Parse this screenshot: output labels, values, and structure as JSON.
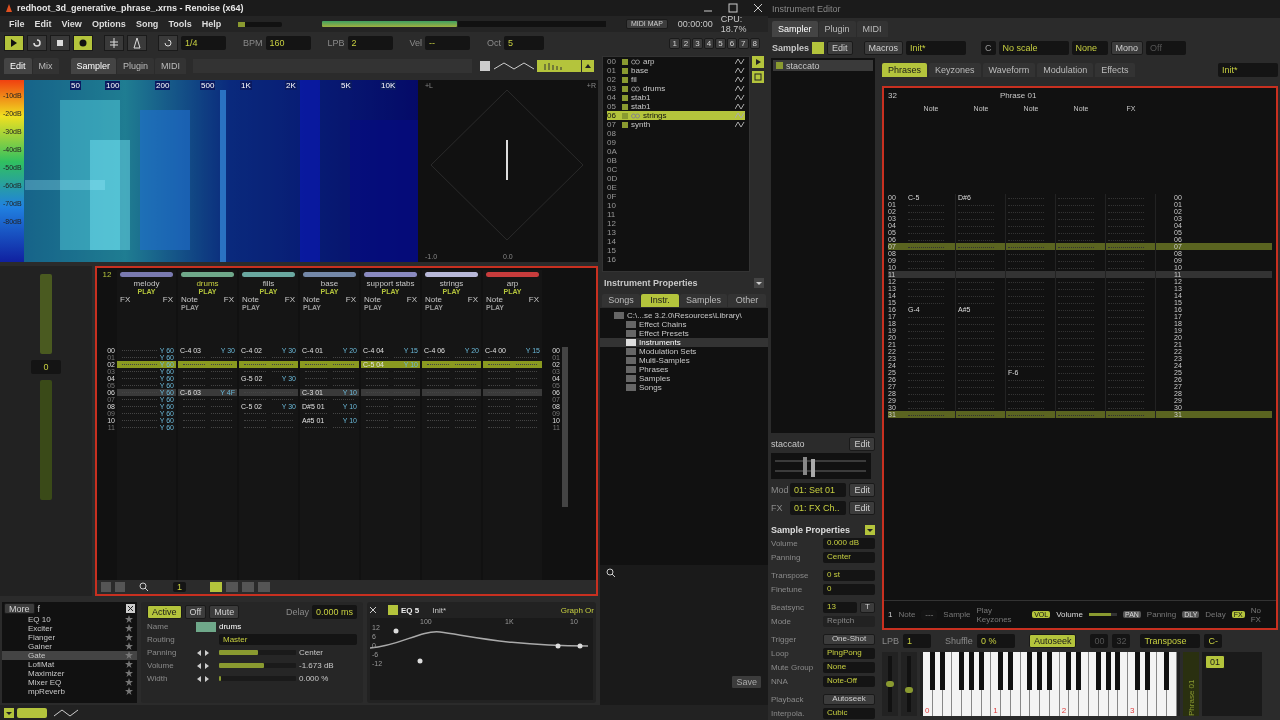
{
  "window": {
    "title": "redhoot_3d_generative_phrase_.xrns - Renoise (x64)"
  },
  "menu": [
    "File",
    "Edit",
    "View",
    "Options",
    "Song",
    "Tools",
    "Help"
  ],
  "transport": {
    "buttons": [
      {
        "kind": "play",
        "on": true
      },
      {
        "kind": "loop",
        "on": false
      },
      {
        "kind": "stop",
        "on": false
      },
      {
        "kind": "record",
        "on": true
      }
    ],
    "quantize": "1/4",
    "bpm_label": "BPM",
    "bpm": "160",
    "lpb_label": "LPB",
    "lpb": "2",
    "vel_label": "Vel",
    "vel": "--",
    "oct_label": "Oct",
    "oct": "5"
  },
  "status": {
    "master_volume": {
      "level": 0.15
    },
    "midi_map": "MIDI MAP",
    "time": "00:00:00",
    "cpu": "CPU: 18.7%",
    "track_buttons": [
      "1",
      "2",
      "3",
      "4",
      "5",
      "6",
      "7",
      "8"
    ]
  },
  "view_tabs": [
    {
      "label": "Edit",
      "selected": true
    },
    {
      "label": "Mix",
      "selected": false
    }
  ],
  "lower_tabs": [
    {
      "label": "Sampler",
      "selected": true
    },
    {
      "label": "Plugin",
      "selected": false
    },
    {
      "label": "MIDI",
      "selected": false
    }
  ],
  "spectrum": {
    "db_labels": [
      "-10dB",
      "-20dB",
      "-30dB",
      "-40dB",
      "-50dB",
      "-60dB",
      "-70dB",
      "-80dB"
    ],
    "freq_labels": [
      "50",
      "100",
      "200",
      "500",
      "1K",
      "2K",
      "5K",
      "10K"
    ],
    "scope_labels": [
      "+L",
      "+R",
      "-1.0",
      "0.0"
    ]
  },
  "mixer_strip": {
    "value": "0"
  },
  "pattern": {
    "lines_label": "12",
    "right_line_numbers": [
      "00",
      "01",
      "02",
      "03",
      "04",
      "05",
      "06",
      "07",
      "08",
      "09",
      "10",
      "11"
    ],
    "line_numbers": [
      {
        "label": "00",
        "kind": "even"
      },
      {
        "label": "01",
        "kind": "odd"
      },
      {
        "label": "02",
        "kind": "play"
      },
      {
        "label": "03",
        "kind": "odd"
      },
      {
        "label": "04",
        "kind": "even"
      },
      {
        "label": "05",
        "kind": "odd"
      },
      {
        "label": "06",
        "kind": "cursor"
      },
      {
        "label": "07",
        "kind": "odd"
      },
      {
        "label": "08",
        "kind": "even"
      },
      {
        "label": "09",
        "kind": "odd"
      },
      {
        "label": "10",
        "kind": "even"
      },
      {
        "label": "11",
        "kind": "odd"
      }
    ],
    "tracks": [
      {
        "name": "melody",
        "color": "#7a7ab0",
        "button_label": "PLAY",
        "columns": [
          "FX",
          "FX"
        ],
        "cells": [
          {
            "fx": "Y 60"
          },
          {
            "fx": "Y 60"
          },
          {
            "fx": "Y 60"
          },
          {
            "fx": "Y 60"
          },
          {
            "fx": "Y 60"
          },
          {
            "fx": "Y 60"
          },
          {
            "fx": "Y 60"
          },
          {
            "fx": "Y 60"
          },
          {
            "fx": "Y 60"
          },
          {
            "fx": "Y 60"
          },
          {
            "fx": "Y 60"
          },
          {
            "fx": "Y 60"
          }
        ]
      },
      {
        "name": "drums",
        "color": "#6fa88a",
        "button_label": "PLAY",
        "columns": [
          "Note",
          "FX"
        ],
        "sub_label": "PLAY",
        "cells": [
          {
            "note": "C-4 03",
            "fx": "Y 30"
          },
          {},
          {},
          {},
          {},
          {},
          {
            "note": "C-6 03",
            "fx": "Y 4F"
          },
          {},
          {},
          {},
          {},
          {}
        ]
      },
      {
        "name": "fills",
        "color": "#6aa8a0",
        "button_label": "PLAY",
        "columns": [
          "Note",
          "FX"
        ],
        "sub_label": "PLAY",
        "cells": [
          {
            "note": "C-4 02",
            "fx": "Y 30"
          },
          {},
          {},
          {},
          {
            "note": "G-5 02",
            "fx": "Y 30"
          },
          {},
          {},
          {},
          {
            "note": "C-5 02",
            "fx": "Y 30"
          },
          {},
          {},
          {}
        ]
      },
      {
        "name": "base",
        "color": "#7488a8",
        "button_label": "PLAY",
        "columns": [
          "Note",
          "FX"
        ],
        "sub_label": "PLAY",
        "cells": [
          {
            "note": "C-4 01",
            "fx": "Y 20"
          },
          {},
          {},
          {},
          {},
          {},
          {
            "note": "C-3 01",
            "fx": "Y 10"
          },
          {},
          {
            "note": "D#5 01",
            "fx": "Y 10"
          },
          {},
          {
            "note": "A#5 01",
            "fx": "Y 10"
          },
          {}
        ]
      },
      {
        "name": "support stabs",
        "color": "#8a8ac0",
        "button_label": "PLAY",
        "columns": [
          "Note",
          "FX"
        ],
        "sub_label": "PLAY",
        "cells": [
          {
            "note": "C-4 04",
            "fx": "Y 15"
          },
          {},
          {
            "note": "C-5 04",
            "fx": "Y 10"
          },
          {},
          {},
          {},
          {},
          {},
          {},
          {},
          {},
          {}
        ]
      },
      {
        "name": "strings",
        "color": "#b8b8d8",
        "button_label": "PLAY",
        "columns": [
          "Note",
          "FX"
        ],
        "sub_label": "PLAY",
        "cells": [
          {
            "note": "C-4 06",
            "fx": "Y 20"
          },
          {},
          {},
          {},
          {},
          {},
          {},
          {},
          {},
          {},
          {},
          {}
        ]
      },
      {
        "name": "arp",
        "color": "#c83c3c",
        "button_label": "PLAY",
        "columns": [
          "Note",
          "FX"
        ],
        "sub_label": "PLAY",
        "cells": [
          {
            "note": "C-4 00",
            "fx": "Y 15"
          },
          {},
          {},
          {},
          {},
          {},
          {},
          {},
          {},
          {},
          {},
          {}
        ]
      }
    ]
  },
  "pattern_toolbar": {
    "value": "1"
  },
  "dsp_list": {
    "more": "More",
    "filter": "f",
    "items": [
      {
        "label": "EQ 10",
        "selected": false
      },
      {
        "label": "Exciter",
        "selected": false
      },
      {
        "label": "Flanger",
        "selected": false
      },
      {
        "label": "Gainer",
        "selected": false
      },
      {
        "label": "Gate",
        "selected": true
      },
      {
        "label": "LofiMat",
        "selected": false
      },
      {
        "label": "Maximizer",
        "selected": false
      },
      {
        "label": "Mixer EQ",
        "selected": false
      },
      {
        "label": "mpReverb",
        "selected": false
      }
    ]
  },
  "track_props": {
    "buttons": [
      {
        "label": "Active",
        "selected": true
      },
      {
        "label": "Off",
        "selected": false
      },
      {
        "label": "Mute",
        "selected": false
      }
    ],
    "delay_label": "Delay",
    "delay": "0.000 ms",
    "name_label": "Name",
    "name": "drums",
    "routing_label": "Routing",
    "routing": "Master",
    "sliders": [
      {
        "label": "Panning",
        "level": 0.5,
        "reading": "Center"
      },
      {
        "label": "Volume",
        "level": 0.58,
        "reading": "-1.673 dB"
      },
      {
        "label": "Width",
        "level": 0.02,
        "reading": "0.000 %"
      }
    ]
  },
  "eq_device": {
    "title": "EQ 5",
    "enabled": true,
    "preset": "Init*",
    "graph_button": "Graph Or",
    "freq_labels": [
      "100",
      "1K",
      "10"
    ],
    "gain_labels": [
      "12",
      "6",
      "0",
      "-6",
      "-12"
    ]
  },
  "instruments": {
    "items": [
      {
        "number": "00",
        "name": "arp",
        "linked": true,
        "selected": false
      },
      {
        "number": "01",
        "name": "base",
        "linked": false,
        "selected": false
      },
      {
        "number": "02",
        "name": "fil",
        "linked": false,
        "selected": false
      },
      {
        "number": "03",
        "name": "drums",
        "linked": true,
        "selected": false
      },
      {
        "number": "04",
        "name": "stab1",
        "linked": false,
        "selected": false
      },
      {
        "number": "05",
        "name": "stab1",
        "linked": false,
        "selected": false
      },
      {
        "number": "06",
        "name": "strings",
        "linked": true,
        "selected": true
      },
      {
        "number": "07",
        "name": "synth",
        "linked": false,
        "selected": false
      },
      {
        "number": "08"
      },
      {
        "number": "09"
      },
      {
        "number": "0A"
      },
      {
        "number": "0B"
      },
      {
        "number": "0C"
      },
      {
        "number": "0D"
      },
      {
        "number": "0E"
      },
      {
        "number": "0F"
      },
      {
        "number": "10"
      },
      {
        "number": "11"
      },
      {
        "number": "12"
      },
      {
        "number": "13"
      },
      {
        "number": "14"
      },
      {
        "number": "15"
      },
      {
        "number": "16"
      }
    ],
    "properties_label": "Instrument Properties"
  },
  "browser": {
    "tabs": [
      {
        "label": "Songs",
        "selected": false
      },
      {
        "label": "Instr.",
        "selected": true
      },
      {
        "label": "Samples",
        "selected": false
      },
      {
        "label": "Other",
        "selected": false
      }
    ],
    "path": "C:\\...se 3.2.0\\Resources\\Library\\",
    "folders": [
      {
        "label": "Effect Chains",
        "selected": false
      },
      {
        "label": "Effect Presets",
        "selected": false
      },
      {
        "label": "Instruments",
        "selected": true
      },
      {
        "label": "Modulation Sets",
        "selected": false
      },
      {
        "label": "Multi-Samples",
        "selected": false
      },
      {
        "label": "Phrases",
        "selected": false
      },
      {
        "label": "Samples",
        "selected": false
      },
      {
        "label": "Songs",
        "selected": false
      }
    ],
    "save": "Save"
  },
  "instrument_editor": {
    "title": "Instrument Editor",
    "tabs": [
      {
        "label": "Sampler",
        "selected": true
      },
      {
        "label": "Plugin",
        "selected": false
      },
      {
        "label": "MIDI",
        "selected": false
      }
    ],
    "samples_label": "Samples",
    "samples_edit": "Edit",
    "macros": "Macros",
    "preset": "Init*",
    "key": "C",
    "scale": "No scale",
    "chord": "None",
    "mono": "Mono",
    "glide": "Off",
    "samples": [
      {
        "name": "staccato",
        "selected": true
      }
    ],
    "sample_header": {
      "name": "staccato",
      "edit": "Edit"
    },
    "mod_label": "Mod",
    "mod": "01: Set 01",
    "mod_edit": "Edit",
    "fx_label": "FX",
    "fx": "01: FX Ch..",
    "fx_edit": "Edit",
    "sample_props_title": "Sample Properties",
    "props": [
      {
        "label": "Volume",
        "value": "0.000 dB",
        "kind": "stepper"
      },
      {
        "label": "Panning",
        "value": "Center",
        "kind": "stepper"
      },
      {
        "label": "Transpose",
        "value": "0 st",
        "kind": "stepper"
      },
      {
        "label": "Finetune",
        "value": "0",
        "kind": "stepper"
      },
      {
        "label": "Beatsync",
        "value": "13",
        "kind": "beatsync",
        "extra": "T"
      },
      {
        "label": "Mode",
        "value": "Repitch",
        "kind": "disabled"
      },
      {
        "label": "Trigger",
        "value": "One-Shot",
        "kind": "button"
      },
      {
        "label": "Loop",
        "value": "PingPong",
        "kind": "dropdown"
      },
      {
        "label": "Mute Group",
        "value": "None",
        "kind": "dropdown"
      },
      {
        "label": "NNA",
        "value": "Note-Off",
        "kind": "dropdown"
      },
      {
        "label": "Playback",
        "value": "Autoseek",
        "kind": "button"
      },
      {
        "label": "Interpola.",
        "value": "Cubic",
        "kind": "dropdown"
      }
    ],
    "phrase_tabs": [
      {
        "label": "Phrases",
        "selected": true
      },
      {
        "label": "Keyzones",
        "selected": false
      },
      {
        "label": "Waveform",
        "selected": false
      },
      {
        "label": "Modulation",
        "selected": false
      },
      {
        "label": "Effects",
        "selected": false
      }
    ],
    "phrase_preset": "Init*",
    "phrase": {
      "lines_label": "32",
      "right_labels": [
        "00",
        "01",
        "02",
        "03",
        "04",
        "05",
        "06",
        "07",
        "08",
        "09",
        "10",
        "11",
        "12",
        "13",
        "14",
        "15",
        "16",
        "17",
        "18",
        "19",
        "20",
        "21",
        "22",
        "23",
        "24",
        "25",
        "26",
        "27",
        "28",
        "29",
        "30",
        "31"
      ],
      "title": "Phrase 01",
      "columns": [
        "Note",
        "Note",
        "Note",
        "Note",
        "FX"
      ],
      "rows": [
        {
          "label": "00",
          "kind": "even",
          "cells": [
            {
              "note": "C-5"
            },
            {
              "note": "D#6"
            },
            {},
            {}
          ]
        },
        {
          "label": "01",
          "kind": "odd",
          "cells": [
            {},
            {},
            {},
            {}
          ]
        },
        {
          "label": "02",
          "kind": "even",
          "cells": [
            {},
            {},
            {},
            {}
          ]
        },
        {
          "label": "03",
          "kind": "odd",
          "cells": [
            {},
            {},
            {},
            {}
          ]
        },
        {
          "label": "04",
          "kind": "even",
          "cells": [
            {},
            {},
            {},
            {}
          ]
        },
        {
          "label": "05",
          "kind": "odd",
          "cells": [
            {},
            {},
            {},
            {}
          ]
        },
        {
          "label": "06",
          "kind": "even",
          "cells": [
            {},
            {},
            {},
            {}
          ]
        },
        {
          "label": "07",
          "kind": "play",
          "cells": [
            {},
            {},
            {},
            {}
          ]
        },
        {
          "label": "08",
          "kind": "even",
          "cells": [
            {},
            {},
            {},
            {}
          ]
        },
        {
          "label": "09",
          "kind": "odd",
          "cells": [
            {},
            {},
            {},
            {}
          ]
        },
        {
          "label": "10",
          "kind": "even",
          "cells": [
            {},
            {},
            {},
            {}
          ]
        },
        {
          "label": "11",
          "kind": "cursor",
          "cells": [
            {},
            {},
            {},
            {}
          ]
        },
        {
          "label": "12",
          "kind": "even",
          "cells": [
            {},
            {},
            {},
            {}
          ]
        },
        {
          "label": "13",
          "kind": "odd",
          "cells": [
            {},
            {},
            {},
            {}
          ]
        },
        {
          "label": "14",
          "kind": "even",
          "cells": [
            {},
            {},
            {},
            {}
          ]
        },
        {
          "label": "15",
          "kind": "odd",
          "cells": [
            {},
            {},
            {},
            {}
          ]
        },
        {
          "label": "16",
          "kind": "even",
          "cells": [
            {
              "note": "G-4"
            },
            {
              "note": "A#5"
            },
            {},
            {}
          ]
        },
        {
          "label": "17",
          "kind": "odd",
          "cells": [
            {},
            {},
            {},
            {}
          ]
        },
        {
          "label": "18",
          "kind": "even",
          "cells": [
            {},
            {},
            {},
            {}
          ]
        },
        {
          "label": "19",
          "kind": "odd",
          "cells": [
            {},
            {},
            {},
            {}
          ]
        },
        {
          "label": "20",
          "kind": "even",
          "cells": [
            {},
            {},
            {},
            {}
          ]
        },
        {
          "label": "21",
          "kind": "odd",
          "cells": [
            {},
            {},
            {},
            {}
          ]
        },
        {
          "label": "22",
          "kind": "even",
          "cells": [
            {},
            {},
            {},
            {}
          ]
        },
        {
          "label": "23",
          "kind": "odd",
          "cells": [
            {},
            {},
            {},
            {}
          ]
        },
        {
          "label": "24",
          "kind": "even",
          "cells": [
            {},
            {},
            {},
            {}
          ]
        },
        {
          "label": "25",
          "kind": "odd",
          "cells": [
            {},
            {},
            {
              "note": "F-6"
            },
            {}
          ]
        },
        {
          "label": "26",
          "kind": "even",
          "cells": [
            {},
            {},
            {},
            {}
          ]
        },
        {
          "label": "27",
          "kind": "odd",
          "cells": [
            {},
            {},
            {},
            {}
          ]
        },
        {
          "label": "28",
          "kind": "even",
          "cells": [
            {},
            {},
            {},
            {}
          ]
        },
        {
          "label": "29",
          "kind": "odd",
          "cells": [
            {},
            {},
            {},
            {}
          ]
        },
        {
          "label": "30",
          "kind": "even",
          "cells": [
            {},
            {},
            {},
            {}
          ]
        },
        {
          "label": "31",
          "kind": "play",
          "cells": [
            {},
            {},
            {},
            {}
          ]
        }
      ]
    },
    "phrase_bar": {
      "line": "1",
      "note_label": "Note",
      "note": "---",
      "sample_label": "Sample",
      "keyzones": "Play Keyzones",
      "vol_badge": "VOL",
      "vol_label": "Volume",
      "vol_slider": {
        "level": 0.8
      },
      "pan_badge": "PAN",
      "pan_label": "Panning",
      "dly_badge": "DLY",
      "dly_label": "Delay",
      "fx_badge": "FX",
      "fx_label": "No FX"
    },
    "phrase_controls": {
      "lpb_label": "LPB",
      "lpb": "1",
      "shuffle_label": "Shuffle",
      "shuffle": "0 %",
      "autoseek": "Autoseek",
      "loop_start": "00",
      "loop_end": "32",
      "mode": "Transpose",
      "key": "C-"
    },
    "keyboard": {
      "pitch_wheel": {
        "level": 0.5
      },
      "mod_wheel": {
        "level": 0.4
      },
      "octave_labels": [
        "0",
        "1",
        "2",
        "3"
      ],
      "phrase_label": "Phrase 01",
      "phrase_slot": "01"
    }
  }
}
